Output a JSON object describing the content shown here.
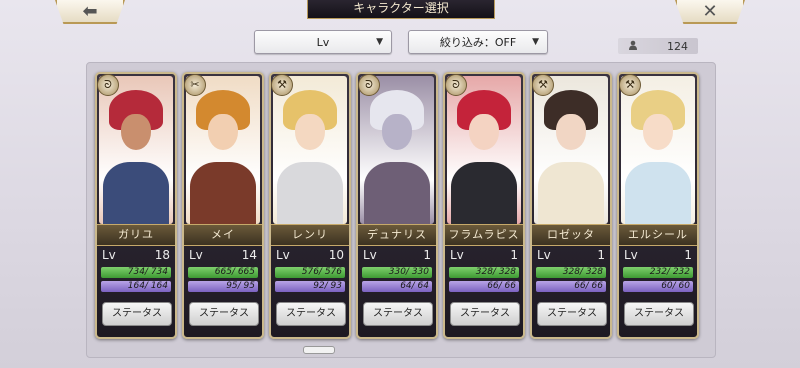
{
  "header": {
    "title": "キャラクター選択",
    "back_symbol": "⬅",
    "close_symbol": "✕"
  },
  "toolbar": {
    "sort_label": "Lv",
    "filter_label": "絞り込み：OFF",
    "dropdown_arrow": "▼",
    "count_icon": "person-icon",
    "count": "124"
  },
  "status_button_label": "ステータス",
  "lv_label": "Lv",
  "characters": [
    {
      "name": "ガリユ",
      "lv": "18",
      "hp": "734/ 734",
      "mp": "164/ 164",
      "type_icon": "ᘐ",
      "hair": "#b52a3a",
      "skin": "#c98f6e",
      "body": "#3b4c7a",
      "bg": "#e9c7b8"
    },
    {
      "name": "メイ",
      "lv": "14",
      "hp": "665/ 665",
      "mp": "95/ 95",
      "type_icon": "✂",
      "hair": "#d3892f",
      "skin": "#f2cfb1",
      "body": "#7a3a2a",
      "bg": "#f0dcc5"
    },
    {
      "name": "レンリ",
      "lv": "10",
      "hp": "576/ 576",
      "mp": "92/ 93",
      "type_icon": "⚒",
      "hair": "#e6c26a",
      "skin": "#f4d8c1",
      "body": "#d9d9dc",
      "bg": "#f3ead7"
    },
    {
      "name": "デュナリス",
      "lv": "1",
      "hp": "330/ 330",
      "mp": "64/ 64",
      "type_icon": "ᘐ",
      "hair": "#e6e6ee",
      "skin": "#b7b2c8",
      "body": "#6e5f76",
      "bg": "#9b8fa6"
    },
    {
      "name": "フラムラピス",
      "lv": "1",
      "hp": "328/ 328",
      "mp": "66/ 66",
      "type_icon": "ᘐ",
      "hair": "#c4233a",
      "skin": "#f4d3c2",
      "body": "#2a2a30",
      "bg": "#e6a8a8"
    },
    {
      "name": "ロゼッタ",
      "lv": "1",
      "hp": "328/ 328",
      "mp": "66/ 66",
      "type_icon": "⚒",
      "hair": "#3d2d27",
      "skin": "#f1d6c4",
      "body": "#efe6d2",
      "bg": "#ece7dd"
    },
    {
      "name": "エルシール",
      "lv": "1",
      "hp": "232/ 232",
      "mp": "60/ 60",
      "type_icon": "⚒",
      "hair": "#e9cf85",
      "skin": "#f7dcc8",
      "body": "#cfe2ee",
      "bg": "#f4efe4"
    }
  ]
}
